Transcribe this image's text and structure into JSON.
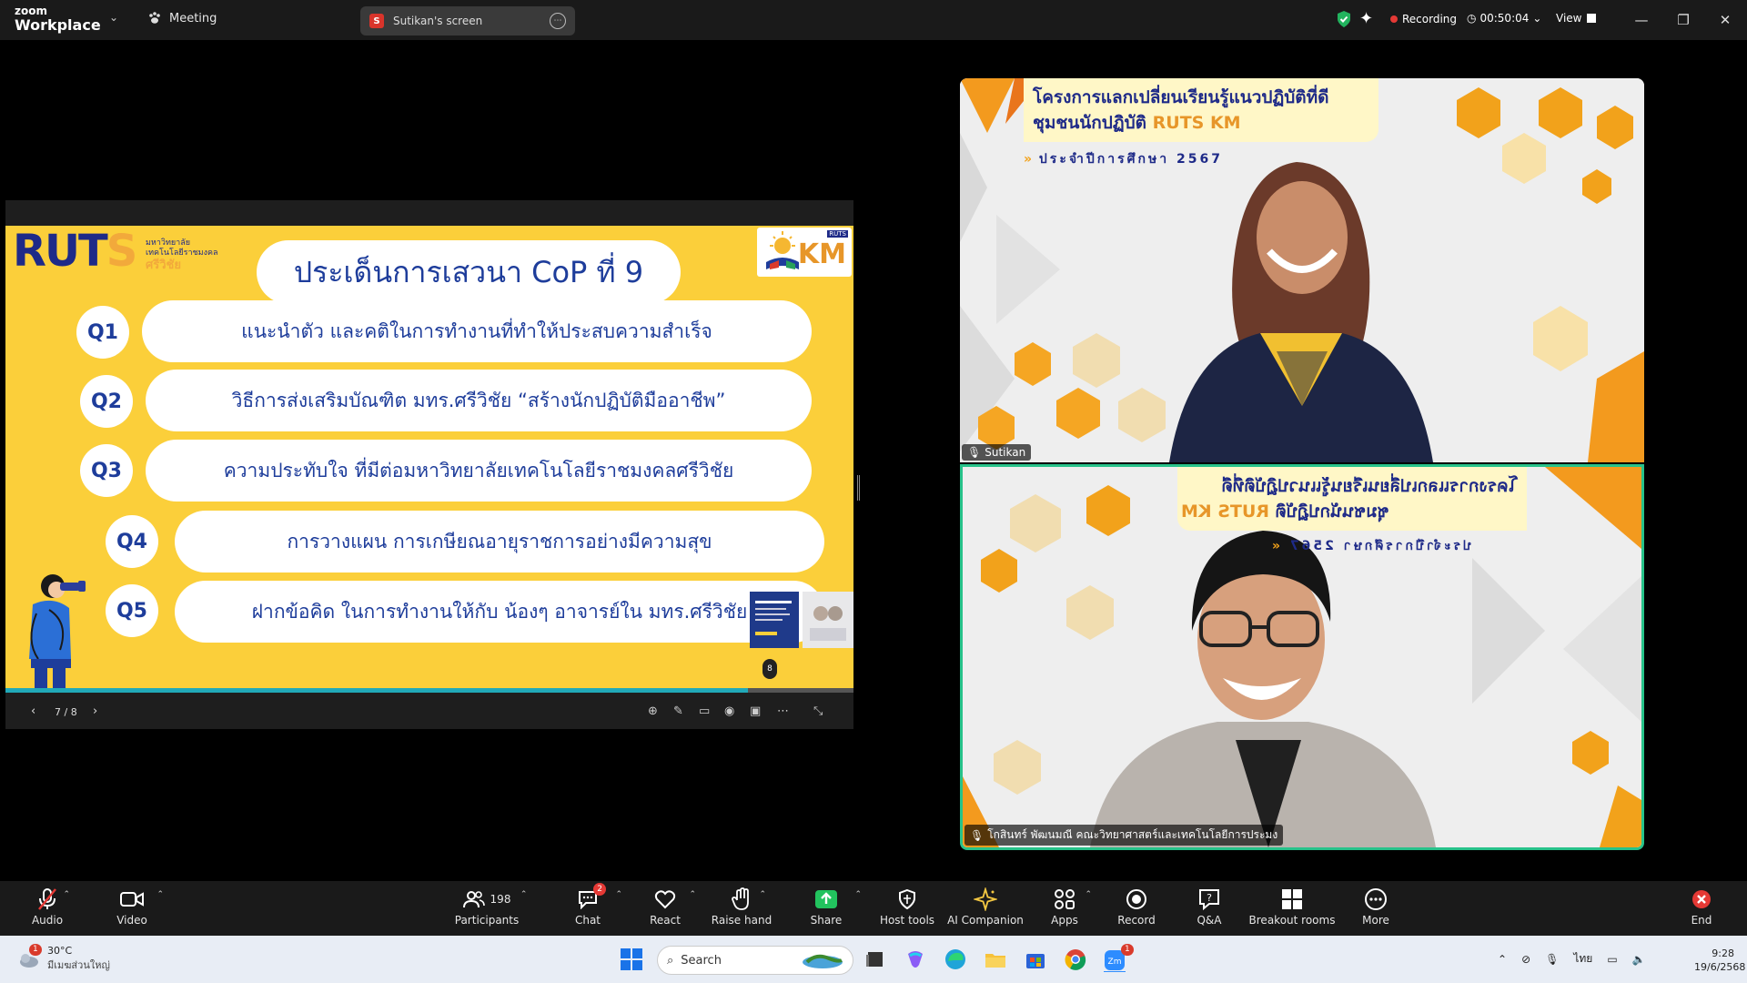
{
  "titlebar": {
    "logo_line1": "zoom",
    "logo_line2": "Workplace",
    "meeting_label": "Meeting",
    "share_tab_badge": "S",
    "share_tab_label": "Sutikan's screen",
    "recording_label": "Recording",
    "timer": "00:50:04",
    "view_label": "View"
  },
  "slide": {
    "logo": "RUT",
    "logo_s": "S",
    "logo_sub1": "มหาวิทยาลัย",
    "logo_sub2": "เทคโนโลยีราชมงคล",
    "logo_sub3": "ศรีวิชัย",
    "km_tag": "RUTS",
    "km_text": "KM",
    "title": "ประเด็นการเสวนา CoP ที่ 9",
    "questions": [
      {
        "num": "Q1",
        "text": "แนะนำตัว และคติในการทำงานที่ทำให้ประสบความสำเร็จ"
      },
      {
        "num": "Q2",
        "text": "วิธีการส่งเสริมบัณฑิต มทร.ศรีวิชัย “สร้างนักปฏิบัติมืออาชีพ”"
      },
      {
        "num": "Q3",
        "text": "ความประทับใจ ที่มีต่อมหาวิทยาลัยเทคโนโลยีราชมงคลศรีวิชัย"
      },
      {
        "num": "Q4",
        "text": "การวางแผน การเกษียณอายุราชการอย่างมีความสุข"
      },
      {
        "num": "Q5",
        "text": "ฝากข้อคิด ในการทำงานให้กับ น้องๆ อาจารย์ใน มทร.ศรีวิชัย"
      }
    ],
    "page_popup": "8",
    "progress_fraction": 0.875,
    "page_indicator": "7 / 8"
  },
  "tiles": [
    {
      "banner_line1": "โครงการแลกเปลี่ยนเรียนรู้แนวปฏิบัติที่ดี",
      "banner_line2_prefix": "ชุมชนนักปฏิบัติ",
      "banner_line2_brand": "RUTS KM",
      "banner_sub": "ประจำปีการศึกษา 2567",
      "name": "Sutikan"
    },
    {
      "banner_line1": "โครงการแลกเปลี่ยนเรียนรู้แนวปฏิบัติที่ดี",
      "banner_line2_prefix": "ชุมชนนักปฏิบัติ",
      "banner_line2_brand": "RUTS KM",
      "banner_sub": "ประจำปีการศึกษา 2567",
      "name": "โกสินทร์ พัฒนมณี คณะวิทยาศาสตร์และเทคโนโลยีการประมง"
    }
  ],
  "toolbar": {
    "audio": "Audio",
    "video": "Video",
    "participants": "Participants",
    "participants_count": "198",
    "chat": "Chat",
    "chat_badge": "2",
    "react": "React",
    "raise_hand": "Raise hand",
    "share": "Share",
    "host_tools": "Host tools",
    "ai_companion": "AI Companion",
    "apps": "Apps",
    "record": "Record",
    "qa": "Q&A",
    "breakout": "Breakout rooms",
    "more": "More",
    "end": "End"
  },
  "taskbar": {
    "weather_badge": "1",
    "temperature": "30°C",
    "weather_desc": "มีเมฆส่วนใหญ่",
    "search_placeholder": "Search",
    "zoom_badge": "1",
    "language": "ไทย",
    "time": "9:28",
    "date": "19/6/2568"
  },
  "colors": {
    "slide_yellow": "#fbcf3a",
    "slide_blue": "#1e3d9b",
    "active_speaker": "#27c28a",
    "recording_red": "#e53935"
  }
}
